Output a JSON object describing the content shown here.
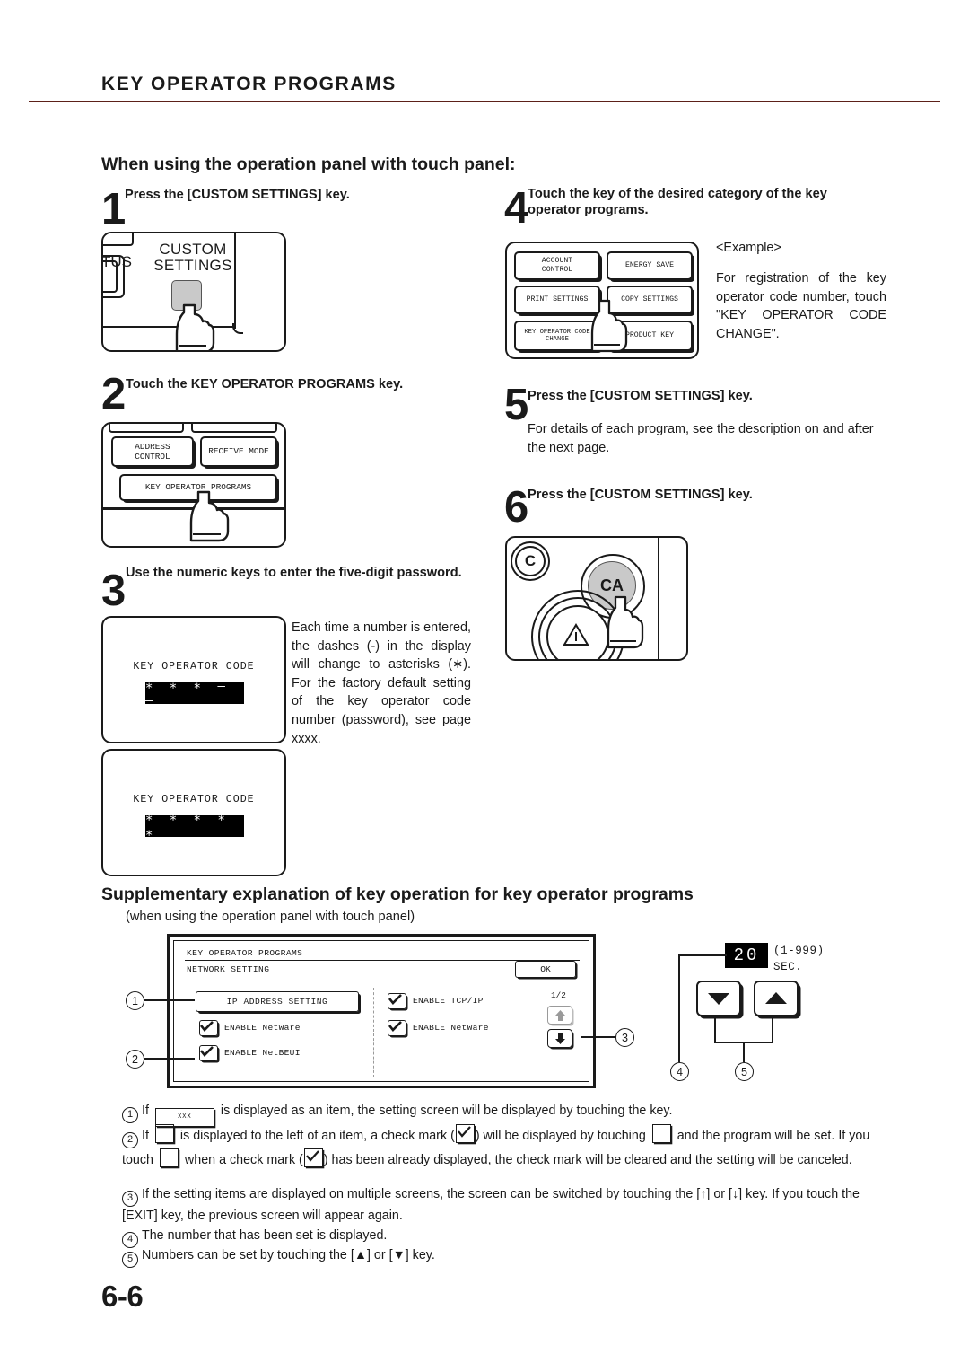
{
  "header": {
    "title": "KEY OPERATOR PROGRAMS",
    "rule_color": "#5c2018"
  },
  "section": {
    "heading": "When using the operation panel with touch panel:"
  },
  "steps": [
    {
      "number": "1",
      "instruction": "Press the [CUSTOM SETTINGS] key.",
      "illustration": {
        "kind": "operation-panel",
        "status_label": "TUS",
        "key_label_line1": "CUSTOM",
        "key_label_line2": "SETTINGS"
      }
    },
    {
      "number": "2",
      "instruction": "Touch the KEY OPERATOR PROGRAMS key.",
      "illustration": {
        "kind": "touch-panel",
        "keys": [
          "ADDRESS\nCONTROL",
          "RECEIVE MODE",
          "KEY OPERATOR PROGRAMS"
        ]
      }
    },
    {
      "number": "3",
      "instruction": "Use the numeric keys to enter the five-digit password.",
      "body": "Each time a number is entered, the dashes (-) in the display will change to asterisks (∗). For the factory default setting of the key operator code number (password), see page xxxx.",
      "displays": [
        {
          "label": "KEY OPERATOR CODE",
          "value": "∗ ∗ ∗ — —"
        },
        {
          "label": "KEY OPERATOR CODE",
          "value": "∗ ∗ ∗ ∗ ∗"
        }
      ]
    },
    {
      "number": "4",
      "instruction": "Touch the key of the desired category of the key operator programs.",
      "example_label": "<Example>",
      "example_body": "For registration of the key operator code number, touch \"KEY OPERATOR CODE CHANGE\".",
      "illustration": {
        "kind": "category-panel",
        "keys": [
          "ACCOUNT\nCONTROL",
          "ENERGY SAVE",
          "PRINT SETTINGS",
          "COPY SETTINGS",
          "KEY OPERATOR CODE\nCHANGE",
          "PRODUCT KEY"
        ]
      }
    },
    {
      "number": "5",
      "instruction": "Press the [CUSTOM SETTINGS] key.",
      "body": "For details of each program, see the description on and after the next page."
    },
    {
      "number": "6",
      "instruction": "Press the [CUSTOM SETTINGS] key.",
      "illustration": {
        "kind": "ca-panel",
        "c_label": "C",
        "ca_label": "CA"
      }
    }
  ],
  "supplementary": {
    "heading": "Supplementary explanation of key operation for key operator programs",
    "subheading": "(when using the operation panel with touch panel)",
    "screen": {
      "title": "KEY OPERATOR PROGRAMS",
      "subtitle": "NETWORK SETTING",
      "ok_label": "OK",
      "ip_button": "IP ADDRESS SETTING",
      "left_items": [
        {
          "label": "ENABLE NetWare",
          "checked": true
        },
        {
          "label": "ENABLE NetBEUI",
          "checked": true
        }
      ],
      "right_items": [
        {
          "label": "ENABLE TCP/IP",
          "checked": true
        },
        {
          "label": "ENABLE NetWare",
          "checked": true
        }
      ],
      "page_indicator": "1/2",
      "up_arrow": "⬆",
      "down_arrow": "⬇"
    },
    "numeric_setter": {
      "value": "20",
      "range": "(1-999)",
      "unit": "SEC.",
      "down_key": "▼",
      "up_key": "▲"
    },
    "callouts": [
      "1",
      "2",
      "3",
      "4",
      "5"
    ]
  },
  "notes": [
    {
      "num": "1",
      "parts": [
        {
          "t": "text",
          "v": "If "
        },
        {
          "t": "key",
          "v": "XXX"
        },
        {
          "t": "text",
          "v": " is displayed as an item, the setting screen will be displayed by touching the key."
        }
      ]
    },
    {
      "num": "2",
      "parts": [
        {
          "t": "text",
          "v": "If "
        },
        {
          "t": "box",
          "v": ""
        },
        {
          "t": "text",
          "v": " is displayed to the left of an item, a check mark ("
        },
        {
          "t": "chk",
          "v": ""
        },
        {
          "t": "text",
          "v": ") will be displayed by touching "
        },
        {
          "t": "box",
          "v": ""
        },
        {
          "t": "text",
          "v": " and the program will be set. If you touch "
        },
        {
          "t": "box",
          "v": ""
        },
        {
          "t": "text",
          "v": " when a check mark ("
        },
        {
          "t": "chk",
          "v": ""
        },
        {
          "t": "text",
          "v": ") has been already displayed, the check mark will be cleared and the setting will be canceled."
        }
      ]
    },
    {
      "num": "3",
      "parts": [
        {
          "t": "text",
          "v": "If the setting items are displayed on multiple screens, the screen can be switched by touching the [↑] or [↓] key. If you touch the [EXIT] key, the previous screen will appear again."
        }
      ]
    },
    {
      "num": "4",
      "parts": [
        {
          "t": "text",
          "v": "The number that has been set is displayed."
        }
      ]
    },
    {
      "num": "5",
      "parts": [
        {
          "t": "text",
          "v": "Numbers can be set by touching the [▲] or [▼] key."
        }
      ]
    }
  ],
  "footer": {
    "page_number": "6-6"
  }
}
